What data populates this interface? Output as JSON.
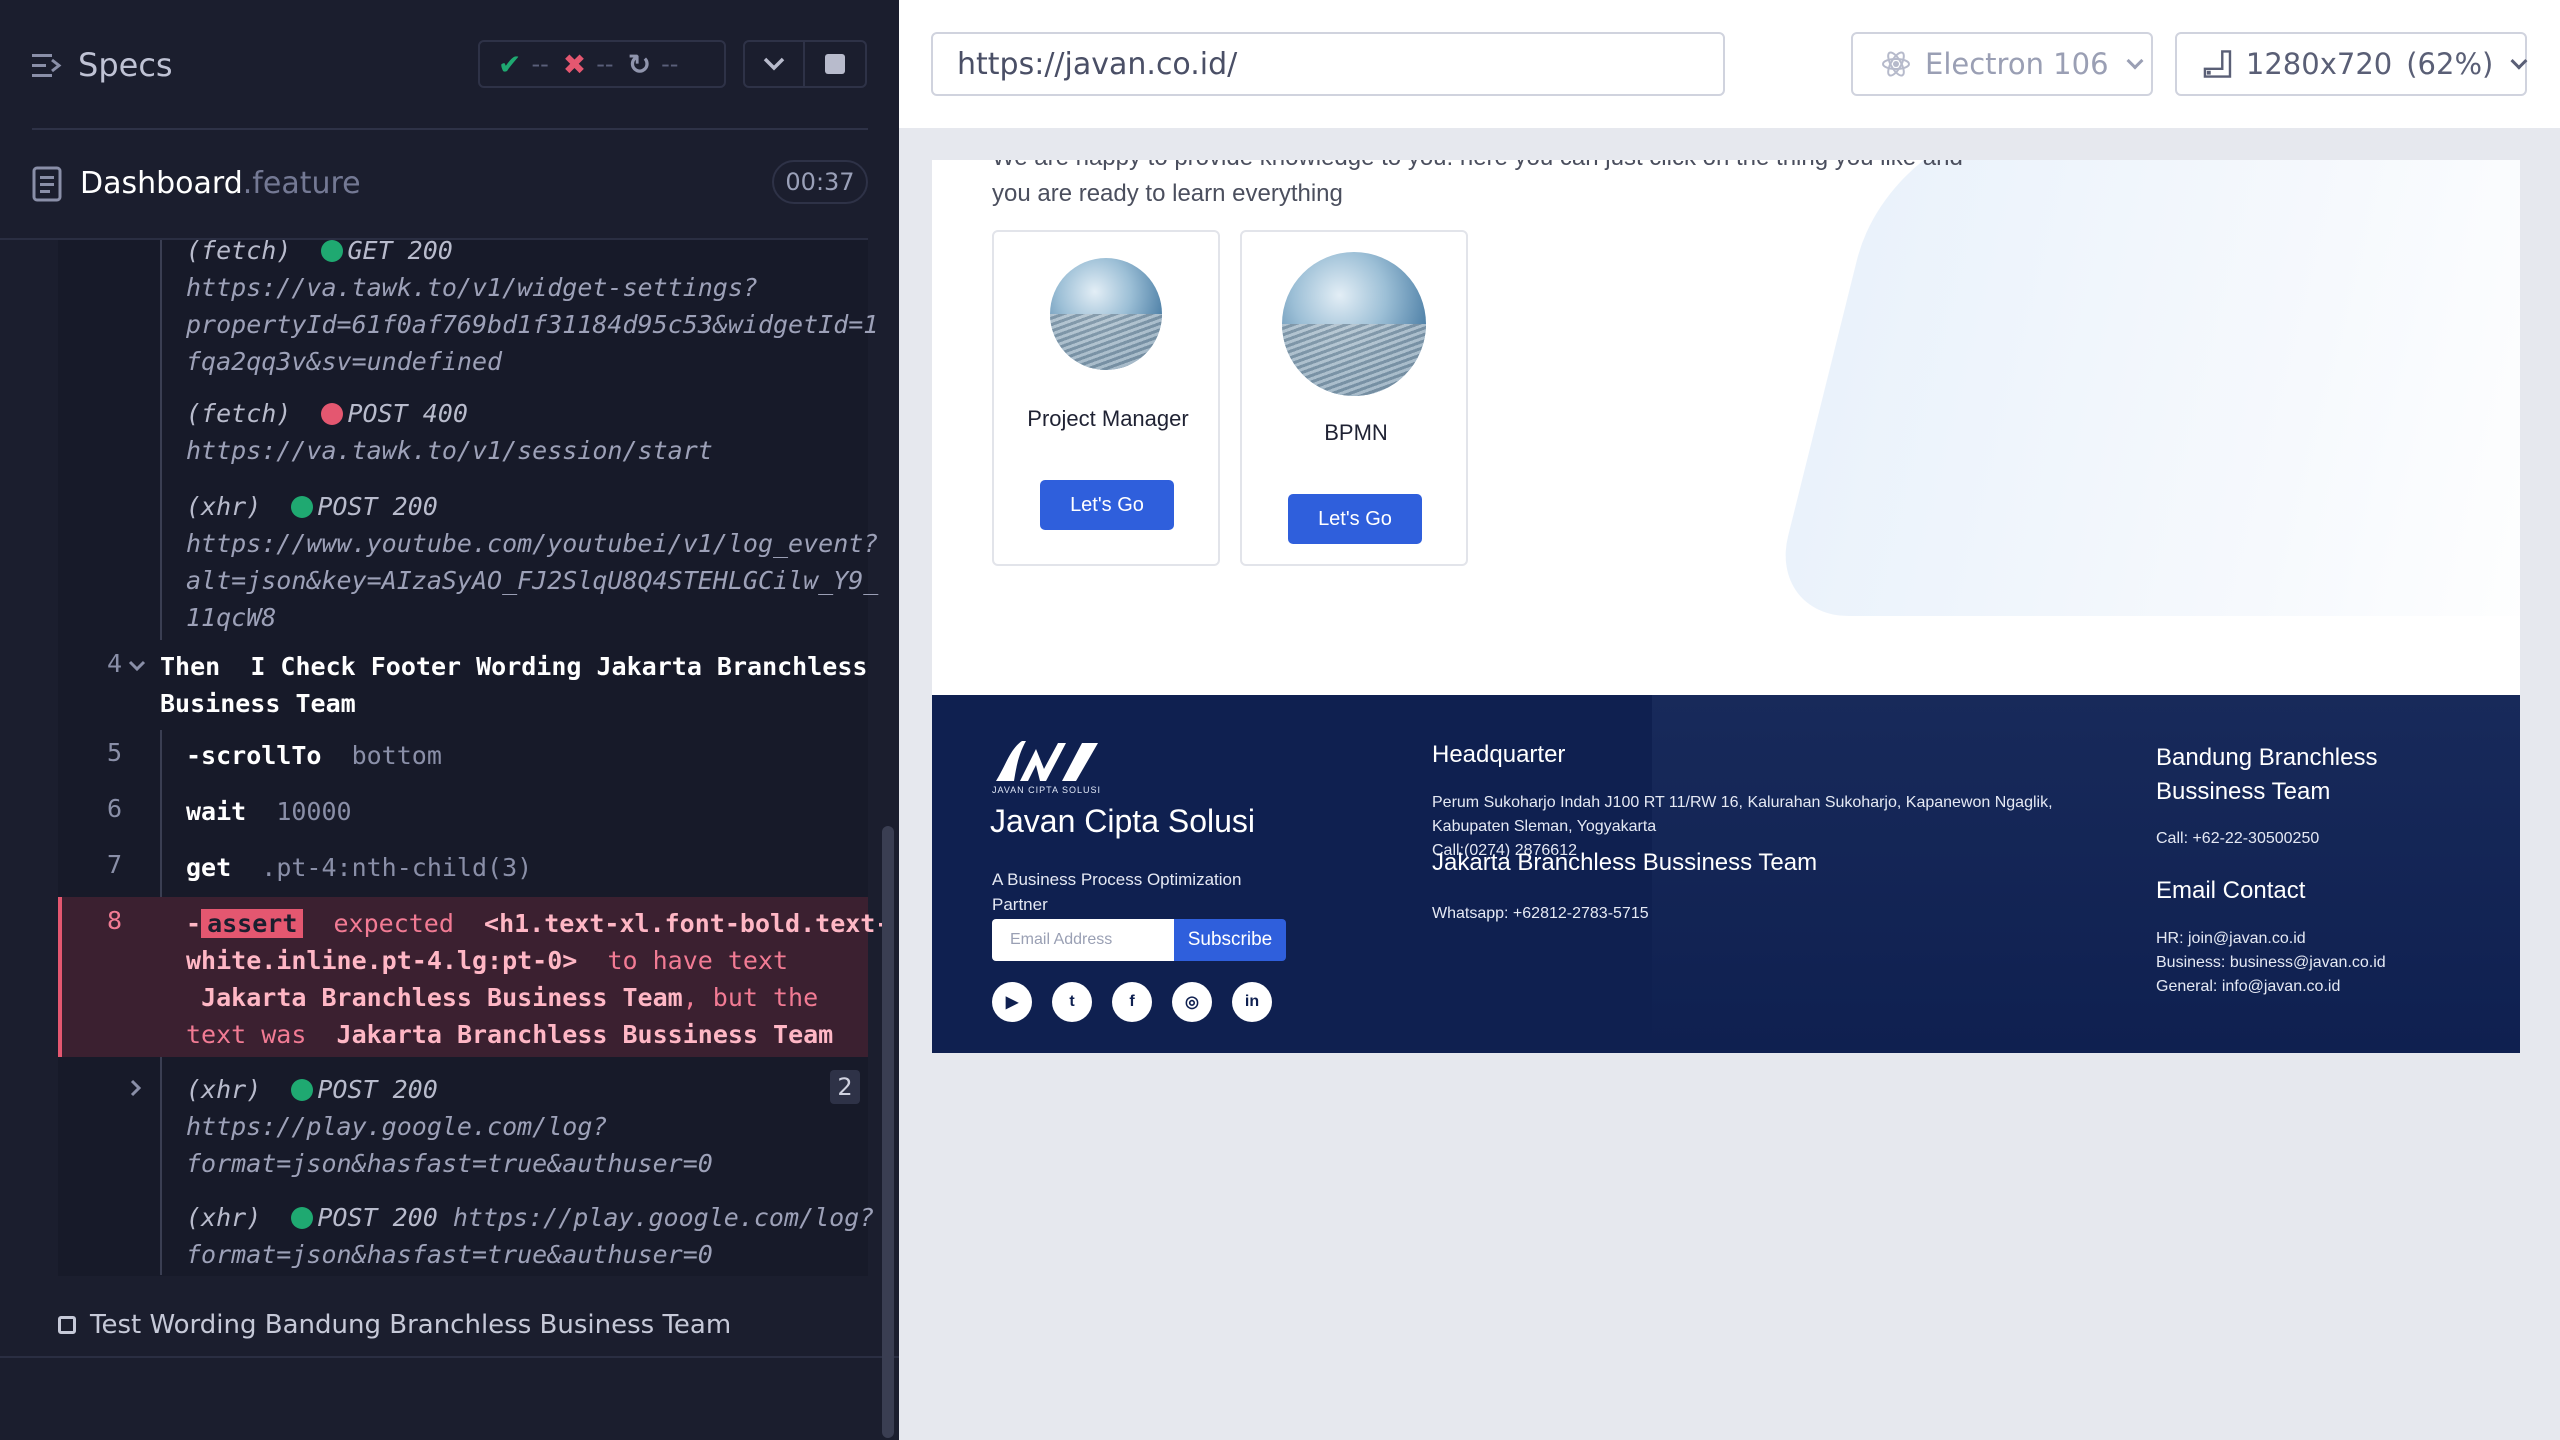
{
  "reporter": {
    "title": "Specs",
    "stats": {
      "passed": "--",
      "failed": "--",
      "pending": "--"
    },
    "spec": {
      "name": "Dashboard",
      "ext": ".feature",
      "duration": "00:37"
    },
    "log": [
      {
        "type": "fetch",
        "method": "GET 200",
        "url1": "https://va.tawk.to/v1/widget-settings?",
        "url2": "propertyId=61f0af769bd1f31184d95c53&widgetId=1",
        "url3": "fqa2qq3v&sv=undefined"
      },
      {
        "type": "fetch",
        "method": "POST 400",
        "url1": "https://va.tawk.to/v1/session/start"
      },
      {
        "type": "xhr",
        "method": "POST 200",
        "url1": "https://www.youtube.com/youtubei/v1/log_event?",
        "url2": "alt=json&key=AIzaSyAO_FJ2SlqU8Q4STEHLGCilw_Y9_",
        "url3": "11qcW8"
      }
    ],
    "step4": {
      "num": "4",
      "keyword": "Then",
      "text1": "I Check Footer Wording Jakarta Branchless",
      "text2": "Business Team"
    },
    "cmd5": {
      "num": "5",
      "name": "-scrollTo",
      "arg": "bottom"
    },
    "cmd6": {
      "num": "6",
      "name": "wait",
      "arg": "10000"
    },
    "cmd7": {
      "num": "7",
      "name": "get",
      "arg": ".pt-4:nth-child(3)"
    },
    "cmd8": {
      "num": "8",
      "prefix": "-",
      "tag": "assert",
      "expected": "expected",
      "selector1": "<h1.text-xl.font-bold.text-",
      "selector2": "white.inline.pt-4.lg:pt-0>",
      "to_have_text": "to have text",
      "expected_text": "Jakarta Branchless Business Team",
      "but": ", but the",
      "text_was": "text was",
      "actual_text": "Jakarta Branchless Bussiness Team"
    },
    "xhr_after": [
      {
        "type": "xhr",
        "method": "POST 200",
        "url1": "https://play.google.com/log?",
        "url2": "format=json&hasfast=true&authuser=0",
        "count": "2"
      },
      {
        "type": "xhr",
        "method": "POST 200",
        "url1": "https://play.google.com/log?",
        "url2": "format=json&hasfast=true&authuser=0"
      }
    ],
    "next_test": "Test Wording Bandung Branchless Business Team"
  },
  "aut": {
    "url": "https://javan.co.id/",
    "browser": "Electron 106",
    "viewport": "1280x720",
    "scale": "(62%)"
  },
  "page": {
    "intro": "We are happy to provide knowledge to you. here you can just click on the thing you like and you are ready to learn everything",
    "cards": [
      {
        "title": "Project Manager",
        "button": "Let's Go"
      },
      {
        "title": "BPMN",
        "button": "Let's Go"
      }
    ],
    "footer": {
      "logo_sub": "JAVAN CIPTA SOLUSI",
      "brand": "Javan Cipta Solusi",
      "tagline": "A Business Process Optimization Partner",
      "email_placeholder": "Email Address",
      "subscribe": "Subscribe",
      "hq_title": "Headquarter",
      "hq_line1": "Perum Sukoharjo Indah J100 RT 11/RW 16, Kalurahan Sukoharjo, Kapanewon Ngaglik,",
      "hq_line2": "Kabupaten Sleman, Yogyakarta",
      "hq_call": "Call:(0274) 2876612",
      "jakarta_title": "Jakarta Branchless Bussiness Team",
      "jakarta_whatsapp": "Whatsapp: +62812-2783-5715",
      "bandung_title1": "Bandung Branchless",
      "bandung_title2": "Bussiness Team",
      "bandung_call": "Call: +62-22-30500250",
      "contact_title": "Email Contact",
      "contact_hr": "HR: join@javan.co.id",
      "contact_business": "Business: business@javan.co.id",
      "contact_general": "General: info@javan.co.id"
    }
  }
}
